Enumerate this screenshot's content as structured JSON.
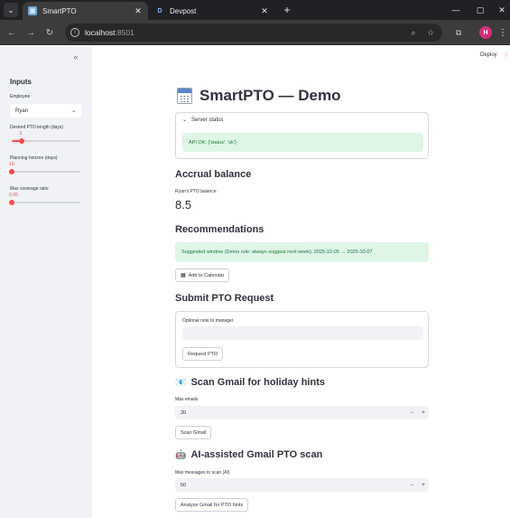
{
  "browser": {
    "tabs": [
      {
        "label": "SmartPTO",
        "close": "✕"
      },
      {
        "label": "Devpost",
        "close": "✕"
      }
    ],
    "tab_menu_glyph": "⌄",
    "new_tab_glyph": "+",
    "devpost_favicon": "D",
    "url_host": "localhost",
    "url_port": ":8501",
    "profile_initial": "H",
    "window_controls": {
      "minimize": "—",
      "maximize": "▢",
      "close": "✕"
    }
  },
  "sidebar": {
    "collapse_glyph": "«",
    "title": "Inputs",
    "employee_label": "Employee",
    "employee_value": "Ryan",
    "sliders": [
      {
        "label": "Desired PTO length (days)",
        "value": "3",
        "fraction": 0.15
      },
      {
        "label": "Planning horizon (days)",
        "value": "10",
        "fraction": 0.0
      },
      {
        "label": "Max coverage ratio",
        "value": "0.05",
        "fraction": 0.0
      }
    ]
  },
  "header": {
    "deploy_label": "Deploy",
    "menu_glyph": "⋮"
  },
  "main": {
    "title": "SmartPTO — Demo",
    "server_status": {
      "label": "Server status",
      "message": "API OK: {'status': 'ok'}"
    },
    "accrual": {
      "heading": "Accrual balance",
      "metric_label": "Ryan's PTO balance",
      "metric_value": "8.5"
    },
    "recommendations": {
      "heading": "Recommendations",
      "message": "Suggested window (Demo rule: always suggest next week): 2025-10-05 → 2025-10-07",
      "calendar_button": "Add to Calendar"
    },
    "submit": {
      "heading": "Submit PTO Request",
      "note_label": "Optional note to manager",
      "note_value": "",
      "button": "Request PTO"
    },
    "gmail_scan": {
      "heading": "Scan Gmail for holiday hints",
      "emoji": "📧",
      "max_label": "Max emails",
      "max_value": "20",
      "button": "Scan Gmail"
    },
    "ai_scan": {
      "heading": "AI-assisted Gmail PTO scan",
      "emoji": "🤖",
      "max_label": "Max messages to scan (AI)",
      "max_value": "50",
      "button": "Analyze Gmail for PTO hints"
    },
    "stepper": {
      "minus": "−",
      "plus": "+"
    }
  }
}
